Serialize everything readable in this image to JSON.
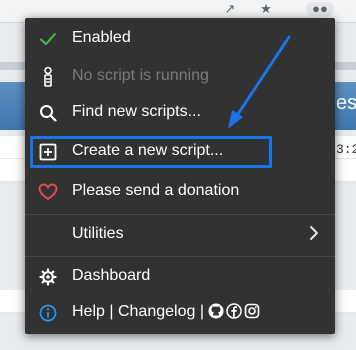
{
  "background": {
    "header_text": "es",
    "time_text": "3:2"
  },
  "menu": {
    "items": [
      {
        "label": "Enabled",
        "icon": "check-icon"
      },
      {
        "label": "No script is running",
        "icon": "info-figure-icon"
      },
      {
        "label": "Find new scripts...",
        "icon": "search-icon"
      },
      {
        "label": "Create a new script...",
        "icon": "plus-square-icon"
      },
      {
        "label": "Please send a donation",
        "icon": "heart-icon"
      },
      {
        "label": "Utilities",
        "icon": "chevron-right-icon"
      },
      {
        "label": "Dashboard",
        "icon": "gear-icon"
      }
    ],
    "help": {
      "help_label": "Help",
      "separator": "|",
      "changelog_label": "Changelog",
      "separator2": "|",
      "icons": [
        "github-icon",
        "facebook-icon",
        "instagram-icon"
      ]
    }
  },
  "colors": {
    "menu_bg": "#323232",
    "check": "#4caf50",
    "heart": "#e04a4a",
    "info": "#2196f3",
    "highlight": "#1a73e8"
  }
}
